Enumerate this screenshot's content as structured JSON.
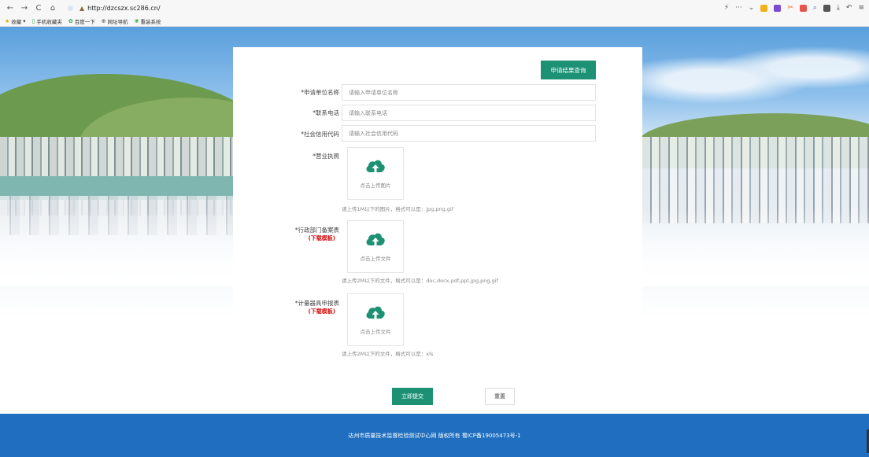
{
  "browser": {
    "url": "http://dzcszx.sc286.cn/",
    "nav": {
      "back": "←",
      "forward": "→",
      "refresh": "C",
      "home": "⌂"
    },
    "bookmarks": [
      {
        "icon": "star-icon",
        "label": "收藏",
        "color": "#e6a700"
      },
      {
        "icon": "mobile-icon",
        "label": "手机收藏夹",
        "color": "#27a84a"
      },
      {
        "icon": "paw-icon",
        "label": "百度一下",
        "color": "#27a84a"
      },
      {
        "icon": "globe-icon",
        "label": "网址导航",
        "color": "#555555"
      },
      {
        "icon": "leaf-icon",
        "label": "重装系统",
        "color": "#27a84a"
      }
    ]
  },
  "form": {
    "query_button": "申请结果查询",
    "fields": [
      {
        "label": "*申请单位名称",
        "placeholder": "请输入申请单位名称"
      },
      {
        "label": "*联系电话",
        "placeholder": "请输入联系电话"
      },
      {
        "label": "*社会信用代码",
        "placeholder": "请输入社会信用代码"
      }
    ],
    "uploads": [
      {
        "label": "*营业执照",
        "download": "",
        "upload_text": "点击上传图片",
        "hint": "请上传1M以下的图片，格式可以是：jpg,png,gif"
      },
      {
        "label": "*行政部门备案表",
        "download": "(下载模板)",
        "upload_text": "点击上传文件",
        "hint": "请上传2M以下的文件，格式可以是：doc,docx,pdf,ppt,jpg,png,gif"
      },
      {
        "label": "*计量器具申报表",
        "download": "(下载模板)",
        "upload_text": "点击上传文件",
        "hint": "请上传2M以下的文件，格式可以是：xls"
      }
    ],
    "submit": "立即提交",
    "reset": "重置"
  },
  "footer": {
    "text": "达州市质量技术监督检验测试中心网 版权所有 蜀ICP备19005473号-1"
  },
  "colors": {
    "primary": "#1c9174",
    "footer": "#1f6ebf",
    "link_red": "#d40b0b"
  }
}
